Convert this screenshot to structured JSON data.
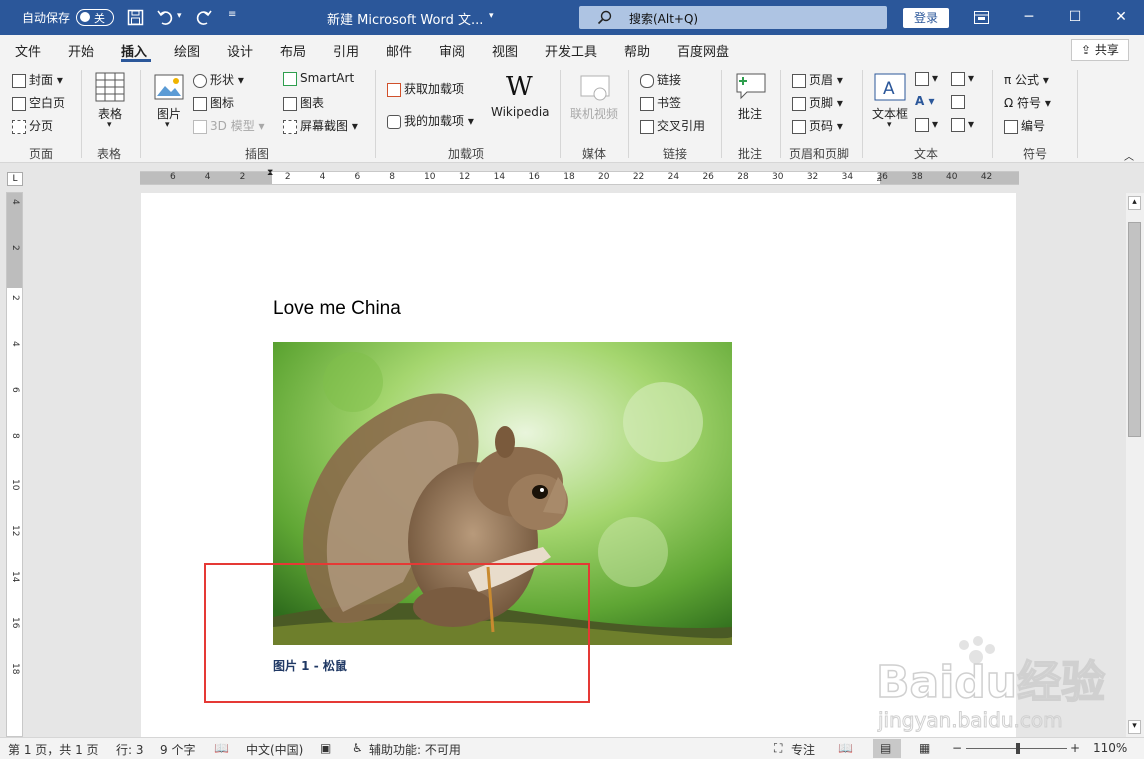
{
  "titlebar": {
    "autosave_label": "自动保存",
    "autosave_state": "关",
    "doc_title": "新建 Microsoft Word 文...",
    "search_label": "搜索(Alt+Q)",
    "login_label": "登录"
  },
  "tabs": [
    "文件",
    "开始",
    "插入",
    "绘图",
    "设计",
    "布局",
    "引用",
    "邮件",
    "审阅",
    "视图",
    "开发工具",
    "帮助",
    "百度网盘"
  ],
  "share_label": "共享",
  "ribbon": {
    "pages": {
      "cover": "封面",
      "blank": "空白页",
      "break": "分页",
      "group": "页面"
    },
    "table": {
      "label": "表格",
      "group": "表格"
    },
    "illustrations": {
      "picture": "图片",
      "shapes": "形状",
      "icons": "图标",
      "model3d": "3D 模型",
      "smartart": "SmartArt",
      "chart": "图表",
      "screenshot": "屏幕截图",
      "group": "插图"
    },
    "addins": {
      "get": "获取加载项",
      "my": "我的加载项",
      "wikipedia": "Wikipedia",
      "group": "加载项"
    },
    "media": {
      "video": "联机视频",
      "group": "媒体"
    },
    "links": {
      "link": "链接",
      "bookmark": "书签",
      "crossref": "交叉引用",
      "group": "链接"
    },
    "comments": {
      "comment": "批注",
      "group": "批注"
    },
    "headerfooter": {
      "header": "页眉",
      "footer": "页脚",
      "pagenum": "页码",
      "group": "页眉和页脚"
    },
    "text": {
      "textbox": "文本框",
      "group": "文本"
    },
    "symbols": {
      "equation": "公式",
      "symbol": "符号",
      "number": "编号",
      "group": "符号"
    }
  },
  "ruler_numbers": [
    "6",
    "4",
    "2",
    "2",
    "4",
    "6",
    "8",
    "10",
    "12",
    "14",
    "16",
    "18",
    "20",
    "22",
    "24",
    "26",
    "28",
    "30",
    "32",
    "34",
    "36",
    "38",
    "40",
    "42"
  ],
  "ruler_v_numbers": [
    "4",
    "2",
    "2",
    "4",
    "6",
    "8",
    "10",
    "12",
    "14",
    "16",
    "18"
  ],
  "document": {
    "heading": "Love me China",
    "caption": "图片 1 - 松鼠"
  },
  "status": {
    "page": "第 1 页，共 1 页",
    "line": "行: 3",
    "words": "9 个字",
    "language": "中文(中国)",
    "accessibility": "辅助功能: 不可用",
    "focus": "专注",
    "zoom": "110%",
    "zoom_level": 1.1
  },
  "watermark": {
    "brand": "Baidu经验",
    "url": "jingyan.baidu.com"
  },
  "colors": {
    "titlebar": "#2b579a",
    "highlight": "#e53935",
    "caption": "#1f3864"
  }
}
